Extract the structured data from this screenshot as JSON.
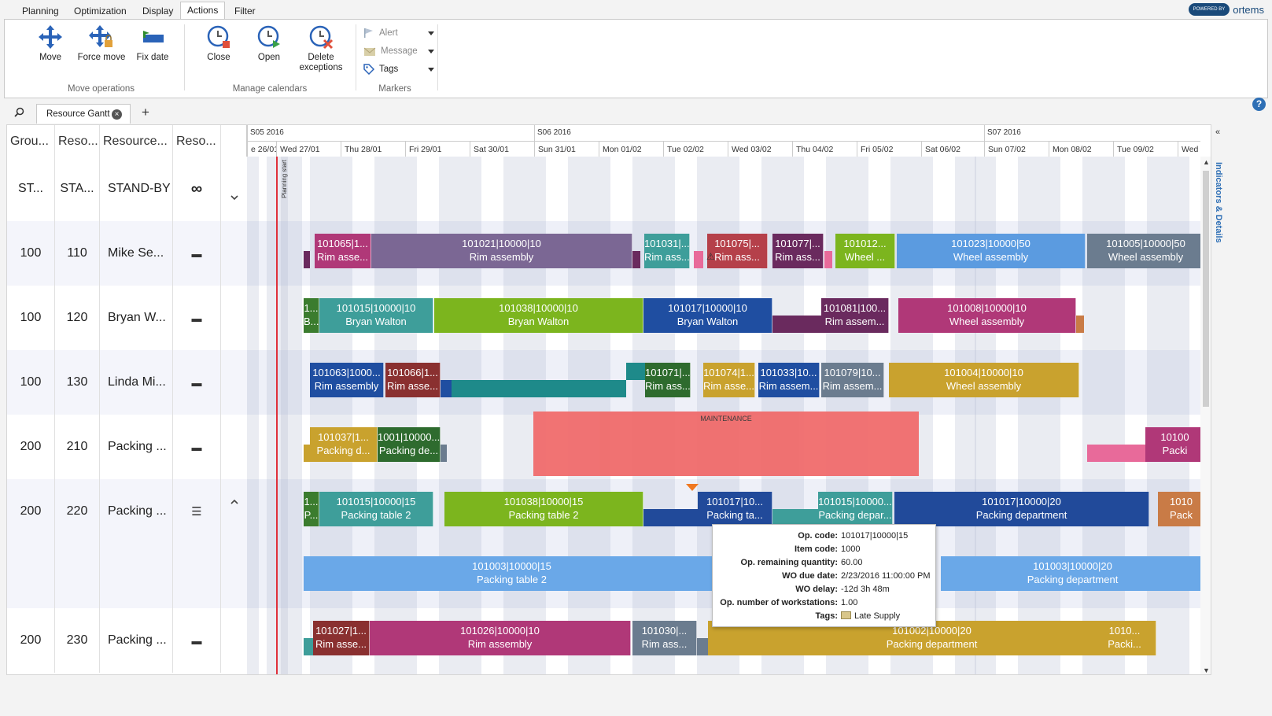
{
  "menu": {
    "tabs": [
      "Planning",
      "Optimization",
      "Display",
      "Actions",
      "Filter"
    ],
    "active": "Actions",
    "logo_badge": "POWERED BY",
    "logo_brand": "ortems"
  },
  "ribbon": {
    "move": "Move",
    "force_move": "Force move",
    "fix_date": "Fix date",
    "group_move": "Move operations",
    "close": "Close",
    "open": "Open",
    "delete_exceptions_1": "Delete",
    "delete_exceptions_2": "exceptions",
    "group_calendars": "Manage calendars",
    "alert": "Alert",
    "message": "Message",
    "tags": "Tags",
    "group_markers": "Markers"
  },
  "doctab": {
    "label": "Resource Gantt"
  },
  "side_panel": {
    "label": "Indicators & Details"
  },
  "columns": [
    "Grou...",
    "Reso...",
    "Resource...",
    "Reso..."
  ],
  "weeks": [
    "S05 2016",
    "S06 2016",
    "S07 2016"
  ],
  "days": [
    "e 26/01",
    "Wed 27/01",
    "Thu 28/01",
    "Fri 29/01",
    "Sat 30/01",
    "Sun 31/01",
    "Mon 01/02",
    "Tue 02/02",
    "Wed 03/02",
    "Thu 04/02",
    "Fri 05/02",
    "Sat 06/02",
    "Sun 07/02",
    "Mon 08/02",
    "Tue 09/02",
    "Wed"
  ],
  "planning_start": "Planning start",
  "maintenance": "MAINTENANCE",
  "rows": [
    {
      "group": "ST...",
      "res": "STA...",
      "name": "STAND-BY",
      "icon": "∞"
    },
    {
      "group": "100",
      "res": "110",
      "name": "Mike Se...",
      "icon": "▬"
    },
    {
      "group": "100",
      "res": "120",
      "name": "Bryan W...",
      "icon": "▬"
    },
    {
      "group": "100",
      "res": "130",
      "name": "Linda Mi...",
      "icon": "▬"
    },
    {
      "group": "200",
      "res": "210",
      "name": "Packing ...",
      "icon": "▬"
    },
    {
      "group": "200",
      "res": "220",
      "name": "Packing ...",
      "icon": "☰"
    },
    {
      "group": "200",
      "res": "230",
      "name": "Packing ...",
      "icon": "▬"
    }
  ],
  "bars": [
    {
      "l1": "101065|1...",
      "l2": "Rim asse..."
    },
    {
      "l1": "101021|10000|10",
      "l2": "Rim assembly"
    },
    {
      "l1": "101031|...",
      "l2": "Rim ass..."
    },
    {
      "l1": "101075|...",
      "l2": "Rim ass..."
    },
    {
      "l1": "101077|...",
      "l2": "Rim ass..."
    },
    {
      "l1": "101012...",
      "l2": "Wheel ..."
    },
    {
      "l1": "101023|10000|50",
      "l2": "Wheel assembly"
    },
    {
      "l1": "101005|10000|50",
      "l2": "Wheel assembly"
    },
    {
      "l1": "1...",
      "l2": "B..."
    },
    {
      "l1": "101015|10000|10",
      "l2": "Bryan Walton"
    },
    {
      "l1": "101038|10000|10",
      "l2": "Bryan Walton"
    },
    {
      "l1": "101017|10000|10",
      "l2": "Bryan Walton"
    },
    {
      "l1": "101081|100...",
      "l2": "Rim assem..."
    },
    {
      "l1": "101008|10000|10",
      "l2": "Wheel assembly"
    },
    {
      "l1": "101063|1000...",
      "l2": "Rim assembly"
    },
    {
      "l1": "101066|1...",
      "l2": "Rim asse..."
    },
    {
      "l1": "101071|...",
      "l2": "Rim ass..."
    },
    {
      "l1": "101074|1...",
      "l2": "Rim asse..."
    },
    {
      "l1": "101033|10...",
      "l2": "Rim assem..."
    },
    {
      "l1": "101079|10...",
      "l2": "Rim assem..."
    },
    {
      "l1": "101004|10000|10",
      "l2": "Wheel assembly"
    },
    {
      "l1": "101037|1...",
      "l2": "Packing d..."
    },
    {
      "l1": "1001|10000...",
      "l2": "Packing de..."
    },
    {
      "l1": "10100",
      "l2": "Packi"
    },
    {
      "l1": "1...",
      "l2": "P..."
    },
    {
      "l1": "101015|10000|15",
      "l2": "Packing table 2"
    },
    {
      "l1": "101038|10000|15",
      "l2": "Packing table 2"
    },
    {
      "l1": "101017|10...",
      "l2": "Packing ta..."
    },
    {
      "l1": "101015|10000...",
      "l2": "Packing depar..."
    },
    {
      "l1": "101017|10000|20",
      "l2": "Packing department"
    },
    {
      "l1": "1010",
      "l2": "Pack"
    },
    {
      "l1": "101003|10000|15",
      "l2": "Packing table 2"
    },
    {
      "l1": "101003|10000|20",
      "l2": "Packing department"
    },
    {
      "l1": "101027|1...",
      "l2": "Rim asse..."
    },
    {
      "l1": "101026|10000|10",
      "l2": "Rim assembly"
    },
    {
      "l1": "101030|...",
      "l2": "Rim ass..."
    },
    {
      "l1": "101002|10000|20",
      "l2": "Packing department"
    },
    {
      "l1": "1010...",
      "l2": "Packi..."
    }
  ],
  "colors": {
    "purple": "#7b6794",
    "teal": "#3e9e9a",
    "red": "#b5404a",
    "darkpurple": "#6a2a5e",
    "lime": "#7cb51e",
    "sky": "#5b9be0",
    "slate": "#6b7c8f",
    "darkgreen": "#2e6b2e",
    "navy": "#1f4ea1",
    "magenta": "#b03878",
    "gold": "#c9a22e",
    "pink": "#e86a9a",
    "maint": "#f06b6b",
    "blue": "#214a9a",
    "orange": "#c97b46",
    "lightblue": "#6aa8e8",
    "olive": "#3b7c2e",
    "brown": "#8a3030",
    "tealdark": "#1e8a8a"
  },
  "tooltip": [
    {
      "k": "Op. code:",
      "v": "101017|10000|15"
    },
    {
      "k": "Item code:",
      "v": "1000"
    },
    {
      "k": "Op. remaining quantity:",
      "v": "60.00"
    },
    {
      "k": "WO due date:",
      "v": "2/23/2016 11:00:00 PM"
    },
    {
      "k": "WO delay:",
      "v": "-12d 3h 48m"
    },
    {
      "k": "Op. number of workstations:",
      "v": "1.00"
    },
    {
      "k": "Tags:",
      "v": "Late Supply"
    }
  ]
}
